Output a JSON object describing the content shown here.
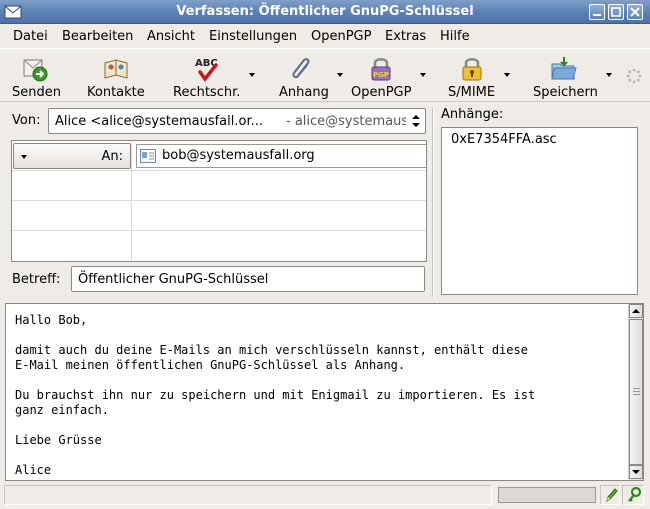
{
  "window": {
    "title": "Verfassen: Öffentlicher GnuPG-Schlüssel"
  },
  "menubar": {
    "items": [
      {
        "label": "Datei"
      },
      {
        "label": "Bearbeiten"
      },
      {
        "label": "Ansicht"
      },
      {
        "label": "Einstellungen"
      },
      {
        "label": "OpenPGP"
      },
      {
        "label": "Extras"
      },
      {
        "label": "Hilfe"
      }
    ]
  },
  "toolbar": {
    "send": "Senden",
    "contacts": "Kontakte",
    "spelling": "Rechtschr.",
    "attach": "Anhang",
    "openpgp": "OpenPGP",
    "smime": "S/MIME",
    "save": "Speichern",
    "spelling_icon_text": "ABC",
    "openpgp_icon_text": "PGP"
  },
  "header": {
    "from_label": "Von:",
    "from_value": "Alice <alice@systemausfall.or...",
    "from_account": "- alice@systemausfall.org",
    "recipient_type": "An:",
    "recipient_value": "bob@systemausfall.org",
    "subject_label": "Betreff:",
    "subject_value": "Öffentlicher GnuPG-Schlüssel"
  },
  "attachments": {
    "label": "Anhänge:",
    "items": [
      "0xE7354FFA.asc"
    ]
  },
  "body": {
    "text": "Hallo Bob,\n\ndamit auch du deine E-Mails an mich verschlüsseln kannst, enthält diese\nE-Mail meinen öffentlichen GnuPG-Schlüssel als Anhang.\n\nDu brauchst ihn nur zu speichern und mit Enigmail zu importieren. Es ist\nganz einfach.\n\nLiebe Grüsse\n\nAlice"
  },
  "colors": {
    "titlebar": "#5a7fb4",
    "window_bg": "#efebe7",
    "field_border": "#8a8784"
  }
}
